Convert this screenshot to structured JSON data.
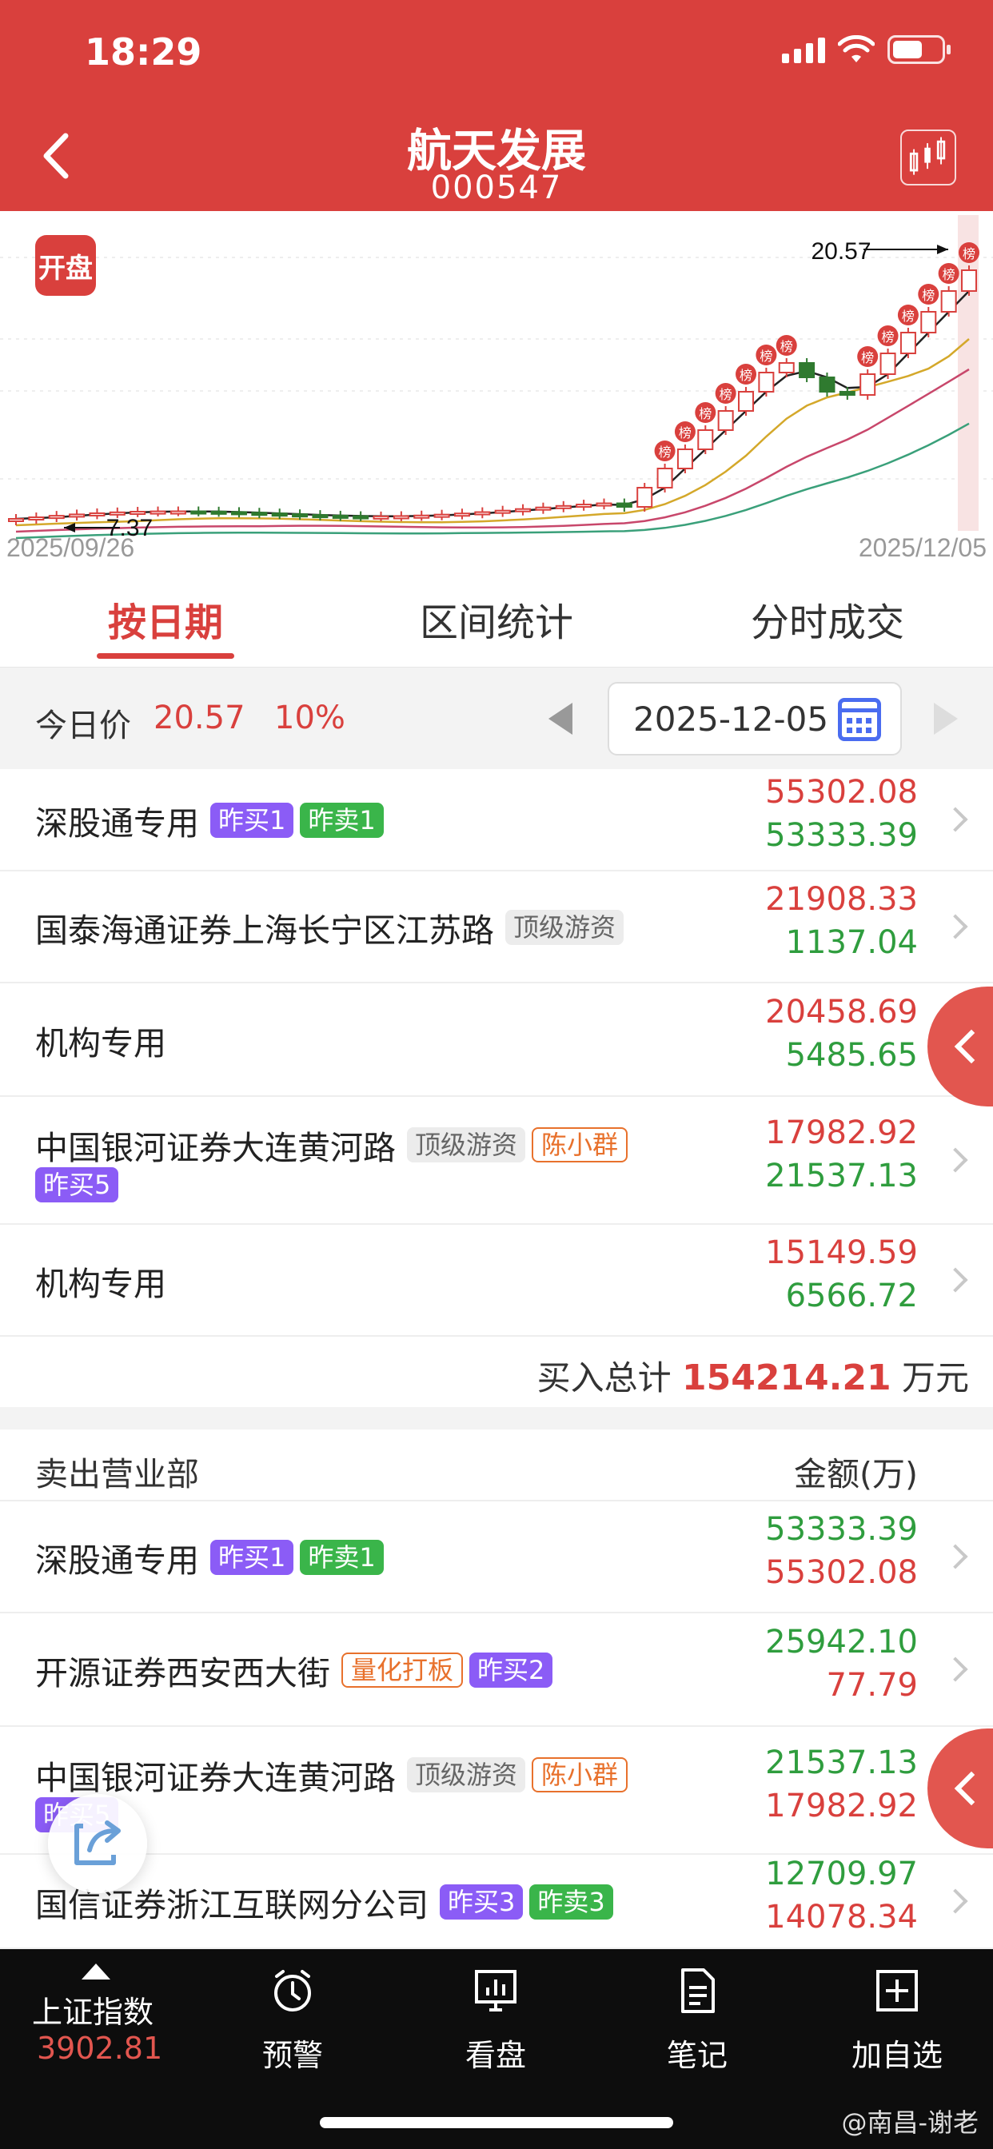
{
  "status": {
    "time": "18:29"
  },
  "header": {
    "title": "航天发展",
    "code": "000547"
  },
  "chart": {
    "badge": "开盘",
    "max_label": "20.57",
    "min_label": "7.37",
    "start_date": "2025/09/26",
    "end_date": "2025/12/05",
    "marker_text": "榜"
  },
  "tabs": [
    {
      "label": "按日期",
      "active": true
    },
    {
      "label": "区间统计",
      "active": false
    },
    {
      "label": "分时成交",
      "active": false
    }
  ],
  "pricebar": {
    "label": "今日价",
    "price": "20.57",
    "pct": "10%",
    "date": "2025-12-05"
  },
  "buy_rows": [
    {
      "name": "深股通专用",
      "tags": [
        {
          "text": "昨买1",
          "style": "purple"
        },
        {
          "text": "昨卖1",
          "style": "green"
        }
      ],
      "v1": "55302.08",
      "v2": "53333.39"
    },
    {
      "name": "国泰海通证券上海长宁区江苏路",
      "tags": [
        {
          "text": "顶级游资",
          "style": "gray"
        }
      ],
      "v1": "21908.33",
      "v2": "1137.04"
    },
    {
      "name": "机构专用",
      "tags": [],
      "v1": "20458.69",
      "v2": "5485.65"
    },
    {
      "name": "中国银河证券大连黄河路",
      "tags": [
        {
          "text": "顶级游资",
          "style": "gray"
        },
        {
          "text": "陈小群",
          "style": "orange"
        }
      ],
      "tags2": [
        {
          "text": "昨买5",
          "style": "purple"
        }
      ],
      "v1": "17982.92",
      "v2": "21537.13"
    },
    {
      "name": "机构专用",
      "tags": [],
      "v1": "15149.59",
      "v2": "6566.72"
    }
  ],
  "total": {
    "label": "买入总计",
    "value": "154214.21",
    "unit": "万元"
  },
  "sell_header": {
    "left": "卖出营业部",
    "right": "金额(万)"
  },
  "sell_rows": [
    {
      "name": "深股通专用",
      "tags": [
        {
          "text": "昨买1",
          "style": "purple"
        },
        {
          "text": "昨卖1",
          "style": "green"
        }
      ],
      "v1": "53333.39",
      "v2": "55302.08"
    },
    {
      "name": "开源证券西安西大街",
      "tags": [
        {
          "text": "量化打板",
          "style": "orange"
        },
        {
          "text": "昨买2",
          "style": "purple"
        }
      ],
      "v1": "25942.10",
      "v2": "77.79"
    },
    {
      "name": "中国银河证券大连黄河路",
      "tags": [
        {
          "text": "顶级游资",
          "style": "gray"
        },
        {
          "text": "陈小群",
          "style": "orange"
        }
      ],
      "tags2": [
        {
          "text": "昨买5",
          "style": "purple"
        }
      ],
      "v1": "21537.13",
      "v2": "17982.92"
    },
    {
      "name": "国信证券浙江互联网分公司",
      "tags": [
        {
          "text": "昨买3",
          "style": "purple"
        },
        {
          "text": "昨卖3",
          "style": "green"
        }
      ],
      "v1": "12709.97",
      "v2": "14078.34"
    }
  ],
  "bottom_nav": {
    "index_name": "上证指数",
    "index_value": "3902.81",
    "items": [
      {
        "label": "预警",
        "icon": "alarm-clock-icon"
      },
      {
        "label": "看盘",
        "icon": "monitor-chart-icon"
      },
      {
        "label": "笔记",
        "icon": "note-icon"
      },
      {
        "label": "加自选",
        "icon": "add-favorite-icon"
      }
    ]
  },
  "watermark": "@南昌-谢老",
  "colors": {
    "brand_red": "#d9403d",
    "up_red": "#d9403d",
    "down_green": "#2f9d3e",
    "tag_purple": "#8b5cf6",
    "tag_green": "#3ab54a"
  }
}
